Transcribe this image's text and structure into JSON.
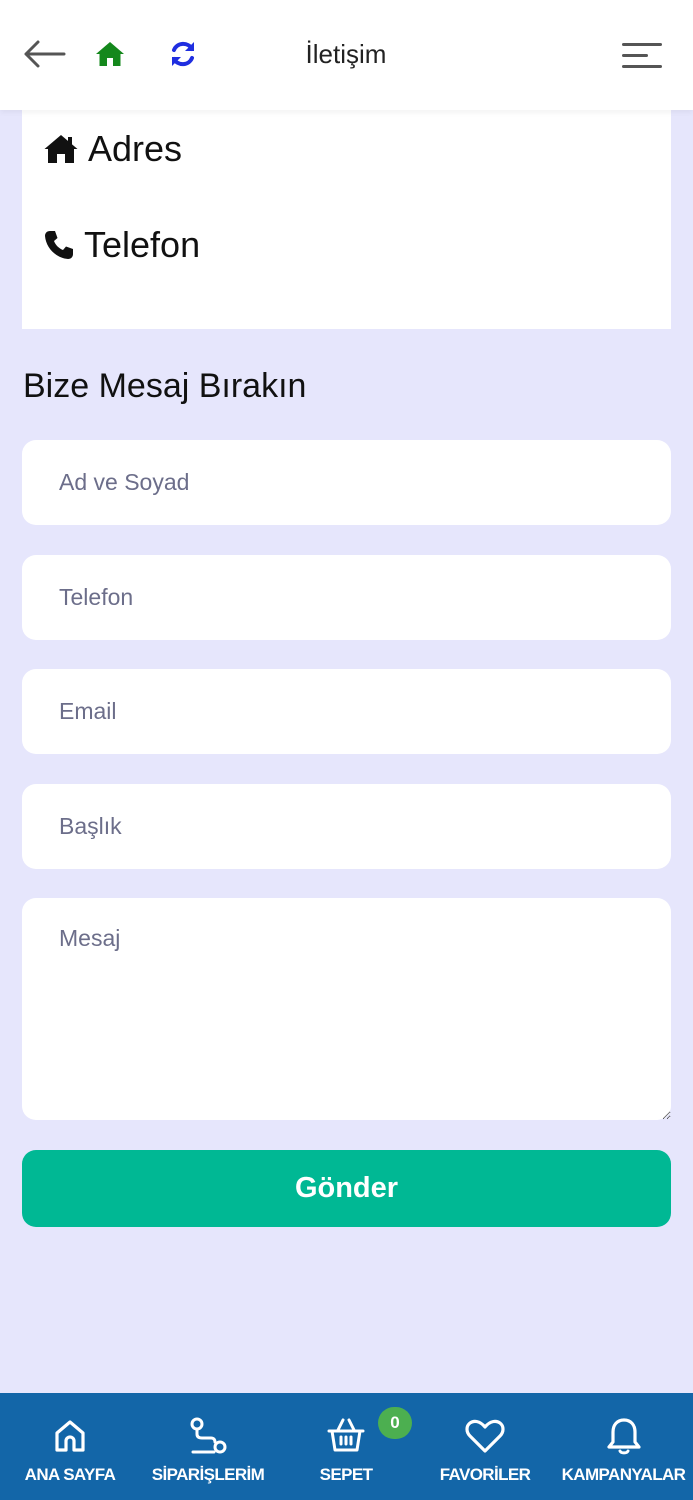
{
  "header": {
    "title": "İletişim",
    "icons": {
      "back": "arrow-left-icon",
      "home": "home-icon",
      "refresh": "refresh-icon",
      "menu": "hamburger-menu-icon"
    },
    "colors": {
      "home": "#14881c",
      "refresh": "#1f2ee0",
      "back": "#555555"
    }
  },
  "contact": {
    "address_label": "Adres",
    "phone_label": "Telefon"
  },
  "form": {
    "title": "Bize Mesaj Bırakın",
    "name_placeholder": "Ad ve Soyad",
    "phone_placeholder": "Telefon",
    "email_placeholder": "Email",
    "subject_placeholder": "Başlık",
    "message_placeholder": "Mesaj",
    "submit_label": "Gönder",
    "submit_color": "#00b894"
  },
  "bottom_nav": {
    "background": "#1366a8",
    "items": [
      {
        "label": "ANA SAYFA",
        "icon": "home-outline-icon"
      },
      {
        "label": "SİPARİŞLERİM",
        "icon": "route-icon"
      },
      {
        "label": "SEPET",
        "icon": "basket-icon",
        "badge": "0"
      },
      {
        "label": "FAVORİLER",
        "icon": "heart-icon"
      },
      {
        "label": "KAMPANYALAR",
        "icon": "bell-icon"
      }
    ]
  }
}
